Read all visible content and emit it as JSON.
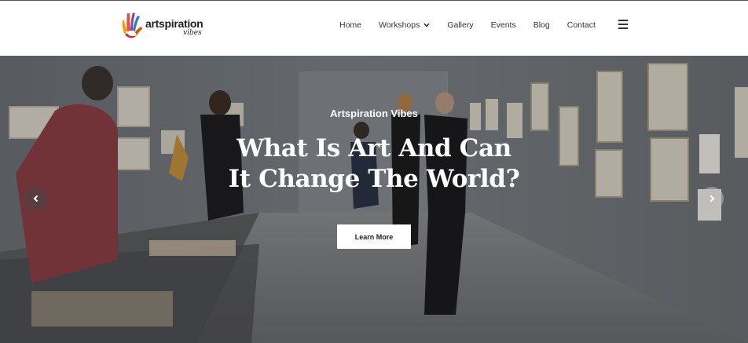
{
  "brand": {
    "name": "artspiration",
    "tagline": "vibes"
  },
  "nav": {
    "items": [
      {
        "label": "Home"
      },
      {
        "label": "Workshops"
      },
      {
        "label": "Gallery"
      },
      {
        "label": "Events"
      },
      {
        "label": "Blog"
      },
      {
        "label": "Contact"
      }
    ],
    "menu_icon": "hamburger-menu-icon",
    "dropdown_icon": "chevron-down-icon"
  },
  "hero": {
    "eyebrow": "Artspiration Vibes",
    "title_line1": "What Is Art And Can",
    "title_line2": "It Change The World?",
    "cta_label": "Learn More",
    "prev_icon": "chevron-left-icon",
    "next_icon": "chevron-right-icon"
  },
  "colors": {
    "text": "#333333",
    "hero_text": "#ffffff",
    "button_bg": "#ffffff"
  }
}
